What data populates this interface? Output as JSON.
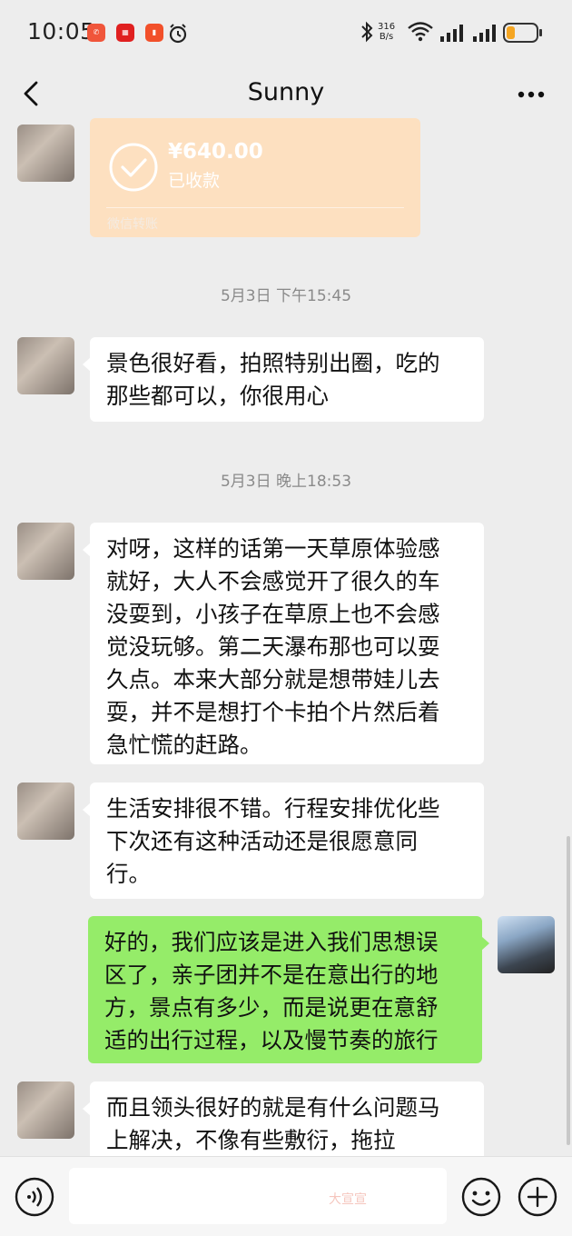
{
  "status_bar": {
    "time": "10:05",
    "speed_value": "316",
    "speed_unit": "B/s"
  },
  "header": {
    "title": "Sunny"
  },
  "transfer": {
    "amount": "¥640.00",
    "status": "已收款",
    "label": "微信转账"
  },
  "messages": [
    {
      "type": "timestamp",
      "text": "5月3日 下午15:45"
    },
    {
      "type": "incoming",
      "lines": [
        "景色很好看，拍照特别出圈，吃的",
        "那些都可以，你很用心"
      ]
    },
    {
      "type": "timestamp",
      "text": "5月3日 晚上18:53"
    },
    {
      "type": "incoming",
      "lines": [
        "对呀，这样的话第一天草原体验感",
        "就好，大人不会感觉开了很久的车",
        "没耍到，小孩子在草原上也不会感",
        "觉没玩够。第二天瀑布那也可以耍",
        "久点。本来大部分就是想带娃儿去",
        "耍，并不是想打个卡拍个片然后着",
        "急忙慌的赶路。"
      ]
    },
    {
      "type": "incoming",
      "lines": [
        "生活安排很不错。行程安排优化些",
        "下次还有这种活动还是很愿意同",
        "行。"
      ]
    },
    {
      "type": "outgoing",
      "lines": [
        "好的，我们应该是进入我们思想误",
        "区了，亲子团并不是在意出行的地",
        "方，景点有多少，而是说更在意舒",
        "适的出行过程，以及慢节奏的旅行"
      ]
    },
    {
      "type": "incoming",
      "lines": [
        "而且领头很好的就是有什么问题马",
        "上解决，不像有些敷衍，拖拉"
      ]
    }
  ],
  "input_bar": {
    "watermark": "大宣宣",
    "voice_icon": "voice-icon",
    "emoji_icon": "emoji-icon",
    "plus_icon": "plus-icon"
  }
}
